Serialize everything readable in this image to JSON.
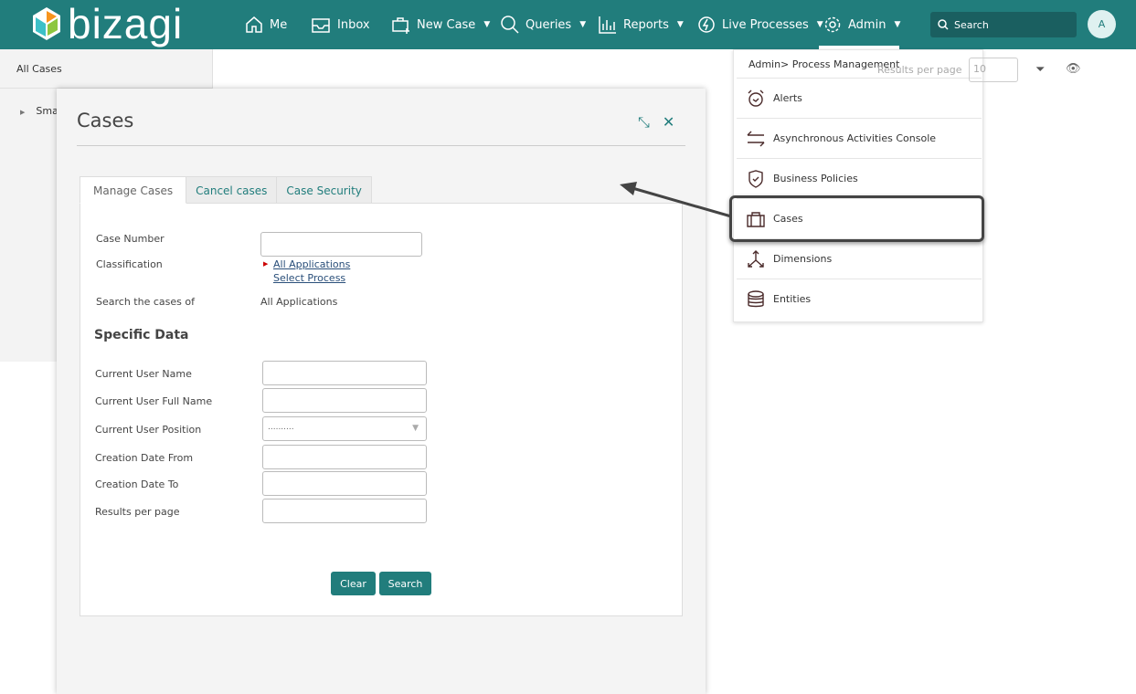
{
  "header": {
    "brand": "bizagi",
    "nav": [
      {
        "label": "Me",
        "icon": "home-icon"
      },
      {
        "label": "Inbox",
        "icon": "inbox-icon"
      },
      {
        "label": "New Case",
        "icon": "new-case-icon"
      },
      {
        "label": "Queries",
        "icon": "search-icon"
      },
      {
        "label": "Reports",
        "icon": "chart-icon"
      },
      {
        "label": "Live Processes",
        "icon": "bolt-icon"
      },
      {
        "label": "Admin",
        "icon": "gear-icon"
      }
    ],
    "search_placeholder": "Search",
    "avatar": "A",
    "accent": "#217d7c"
  },
  "left": {
    "title": "All Cases",
    "item": "Sma"
  },
  "background": {
    "results_per_page": "Results per page",
    "results_value": "10"
  },
  "dialog": {
    "title": "Cases",
    "tabs": [
      "Manage Cases",
      "Cancel cases",
      "Case Security"
    ],
    "form": {
      "case_number": "Case Number",
      "classification": "Classification",
      "all_applications_link": "All Applications",
      "select_process_link": "Select Process",
      "search_cases_of": "Search the cases of",
      "search_cases_of_value": "All Applications",
      "specific_data": "Specific Data",
      "current_user_name": "Current User Name",
      "current_user_full_name": "Current User Full Name",
      "current_user_position": "Current User Position",
      "position_value": "..........",
      "creation_date_from": "Creation Date From",
      "creation_date_to": "Creation Date To",
      "results_per_page": "Results per page"
    },
    "buttons": {
      "clear": "Clear",
      "search": "Search"
    }
  },
  "menu": {
    "breadcrumb": "Admin> Process Management",
    "items": [
      {
        "label": "Alerts",
        "icon": "alarm-clock-icon"
      },
      {
        "label": "Asynchronous Activities Console",
        "icon": "arrows-exchange-icon"
      },
      {
        "label": "Business Policies",
        "icon": "shield-icon"
      },
      {
        "label": "Cases",
        "icon": "briefcase-icon"
      },
      {
        "label": "Dimensions",
        "icon": "dimensions-icon"
      },
      {
        "label": "Entities",
        "icon": "database-icon"
      }
    ],
    "highlighted": "Cases"
  }
}
